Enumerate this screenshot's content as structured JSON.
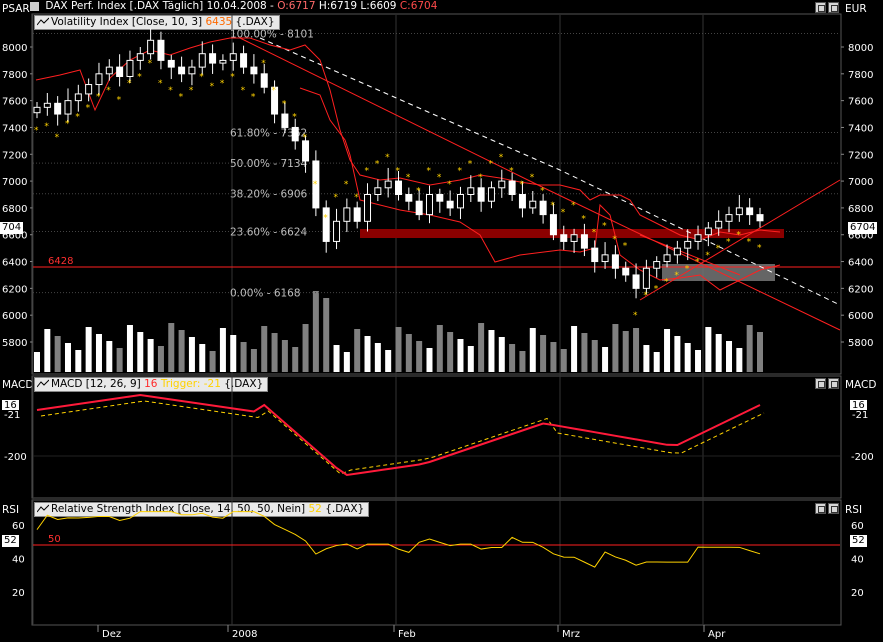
{
  "header": {
    "instrument": "DAX Perf. Index [.DAX Täglich]",
    "date": "10.04.2008",
    "open": "O:6717",
    "high": "H:6719",
    "low": "L:6609",
    "close": "C:6704"
  },
  "panels": {
    "price": {
      "label": "PSAR",
      "right_label": "EUR",
      "legend_prefix": "Volatility Index [Close, 10, 3]",
      "legend_value": "6435",
      "legend_suffix": "{.DAX}",
      "left_value": "704",
      "right_value": "6704"
    },
    "macd": {
      "label": "MACD",
      "right_label": "MACD",
      "legend_prefix": "MACD [12, 26, 9]",
      "legend_value1": "16",
      "legend_value2": "Trigger: -21",
      "legend_suffix": "{.DAX}",
      "left_value1": "16",
      "left_value2": "-21",
      "right_value1": "16",
      "right_value2": "-21"
    },
    "rsi": {
      "label": "RSI",
      "right_label": "RSI",
      "legend_prefix": "Relative Strength Index [Close, 14, 50, 50, Nein]",
      "legend_value": "52",
      "legend_suffix": "{.DAX}",
      "left_value": "52",
      "right_value": "52"
    }
  },
  "price_axis": {
    "ticks": [
      "8000",
      "7800",
      "7600",
      "7400",
      "7200",
      "7000",
      "6800",
      "6600",
      "6400",
      "6200",
      "6000",
      "5800"
    ],
    "right_ticks": [
      "8000",
      "7800",
      "7600",
      "7400",
      "7200",
      "7000",
      "6800",
      "6600",
      "6400",
      "6200",
      "6000",
      "5800"
    ]
  },
  "macd_axis": {
    "ticks": [
      "-200"
    ]
  },
  "rsi_axis": {
    "ticks": [
      "60",
      "40",
      "20"
    ],
    "right_ticks": [
      "60",
      "40",
      "20"
    ]
  },
  "time_axis": {
    "labels": [
      "Dez",
      "2008",
      "Feb",
      "Mrz",
      "Apr"
    ]
  },
  "fibonacci": [
    {
      "label": "100.00% - 8101"
    },
    {
      "label": "61.80% - 7362"
    },
    {
      "label": "50.00% - 7134"
    },
    {
      "label": "38.20% - 6906"
    },
    {
      "label": "23.60% - 6624"
    },
    {
      "label": "0.00% - 6168"
    }
  ],
  "support_label": "6428",
  "rsi_line_label": "50",
  "chart_data": [
    {
      "type": "candlestick",
      "title": "DAX Perf. Index [.DAX Täglich]",
      "ylim": [
        5650,
        8200
      ],
      "series": [
        {
          "name": "Volatility Index [Close, 10, 3]",
          "last": 6435
        },
        {
          "name": "PSAR"
        }
      ],
      "horizontal_levels": [
        8101,
        7362,
        7134,
        6906,
        6624,
        6428,
        6168
      ],
      "closes": [
        7550,
        7580,
        7500,
        7600,
        7650,
        7720,
        7800,
        7850,
        7780,
        7900,
        7950,
        8050,
        7900,
        7850,
        7800,
        7850,
        7950,
        7880,
        7900,
        7950,
        7850,
        7800,
        7700,
        7500,
        7400,
        7300,
        7150,
        6800,
        6550,
        6700,
        6800,
        6700,
        6900,
        6950,
        7000,
        6900,
        6850,
        6750,
        6900,
        6850,
        6800,
        6900,
        6950,
        6850,
        6950,
        7000,
        6900,
        6800,
        6850,
        6750,
        6600,
        6550,
        6600,
        6500,
        6400,
        6450,
        6350,
        6300,
        6200,
        6350,
        6400,
        6450,
        6500,
        6550,
        6600,
        6650,
        6700,
        6750,
        6800,
        6750,
        6704
      ]
    },
    {
      "type": "line",
      "title": "MACD [12, 26, 9]",
      "series": [
        {
          "name": "MACD",
          "last": 16
        },
        {
          "name": "Trigger",
          "last": -21
        }
      ]
    },
    {
      "type": "line",
      "title": "Relative Strength Index [Close, 14, 50, 50, Nein]",
      "series": [
        {
          "name": "RSI",
          "last": 52
        }
      ],
      "ylim": [
        0,
        70
      ]
    }
  ],
  "colors": {
    "background": "#000000",
    "candle_up": "#ffffff",
    "volume_bar": "#ffffff",
    "volume_bar_dim": "#808080",
    "fib_line": "#ff2020",
    "macd": "#ff1a3a",
    "trigger": "#ffd200",
    "rsi": "#ffd200",
    "psar": "#ffd200",
    "support_band": "#8b0000"
  }
}
